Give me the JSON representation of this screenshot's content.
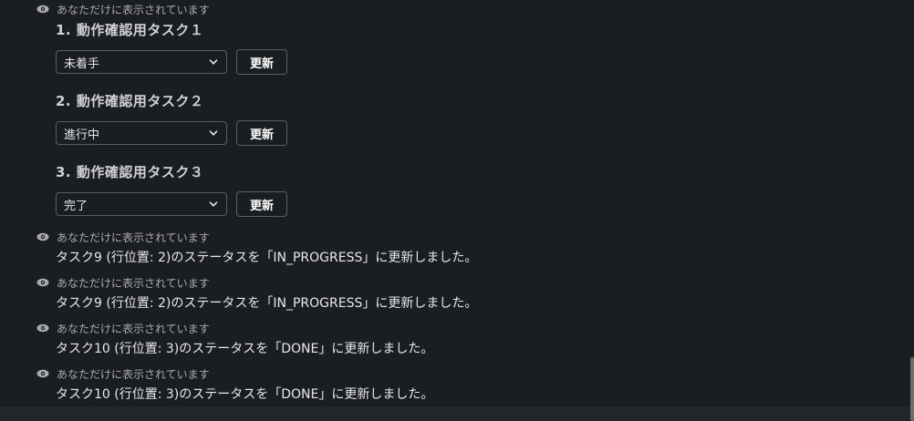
{
  "visibility_notice": "あなただけに表示されています",
  "tasks": [
    {
      "title": "1. 動作確認用タスク１",
      "status": "未着手",
      "button": "更新"
    },
    {
      "title": "2. 動作確認用タスク２",
      "status": "進行中",
      "button": "更新"
    },
    {
      "title": "3. 動作確認用タスク３",
      "status": "完了",
      "button": "更新"
    }
  ],
  "messages": [
    {
      "notice": "あなただけに表示されています",
      "text": "タスク9 (行位置: 2)のステータスを「IN_PROGRESS」に更新しました。"
    },
    {
      "notice": "あなただけに表示されています",
      "text": "タスク9 (行位置: 2)のステータスを「IN_PROGRESS」に更新しました。"
    },
    {
      "notice": "あなただけに表示されています",
      "text": "タスク10 (行位置: 3)のステータスを「DONE」に更新しました。"
    },
    {
      "notice": "あなただけに表示されています",
      "text": "タスク10 (行位置: 3)のステータスを「DONE」に更新しました。"
    }
  ],
  "icons": {
    "visibility": "eye-icon",
    "dropdown": "chevron-down-icon"
  }
}
